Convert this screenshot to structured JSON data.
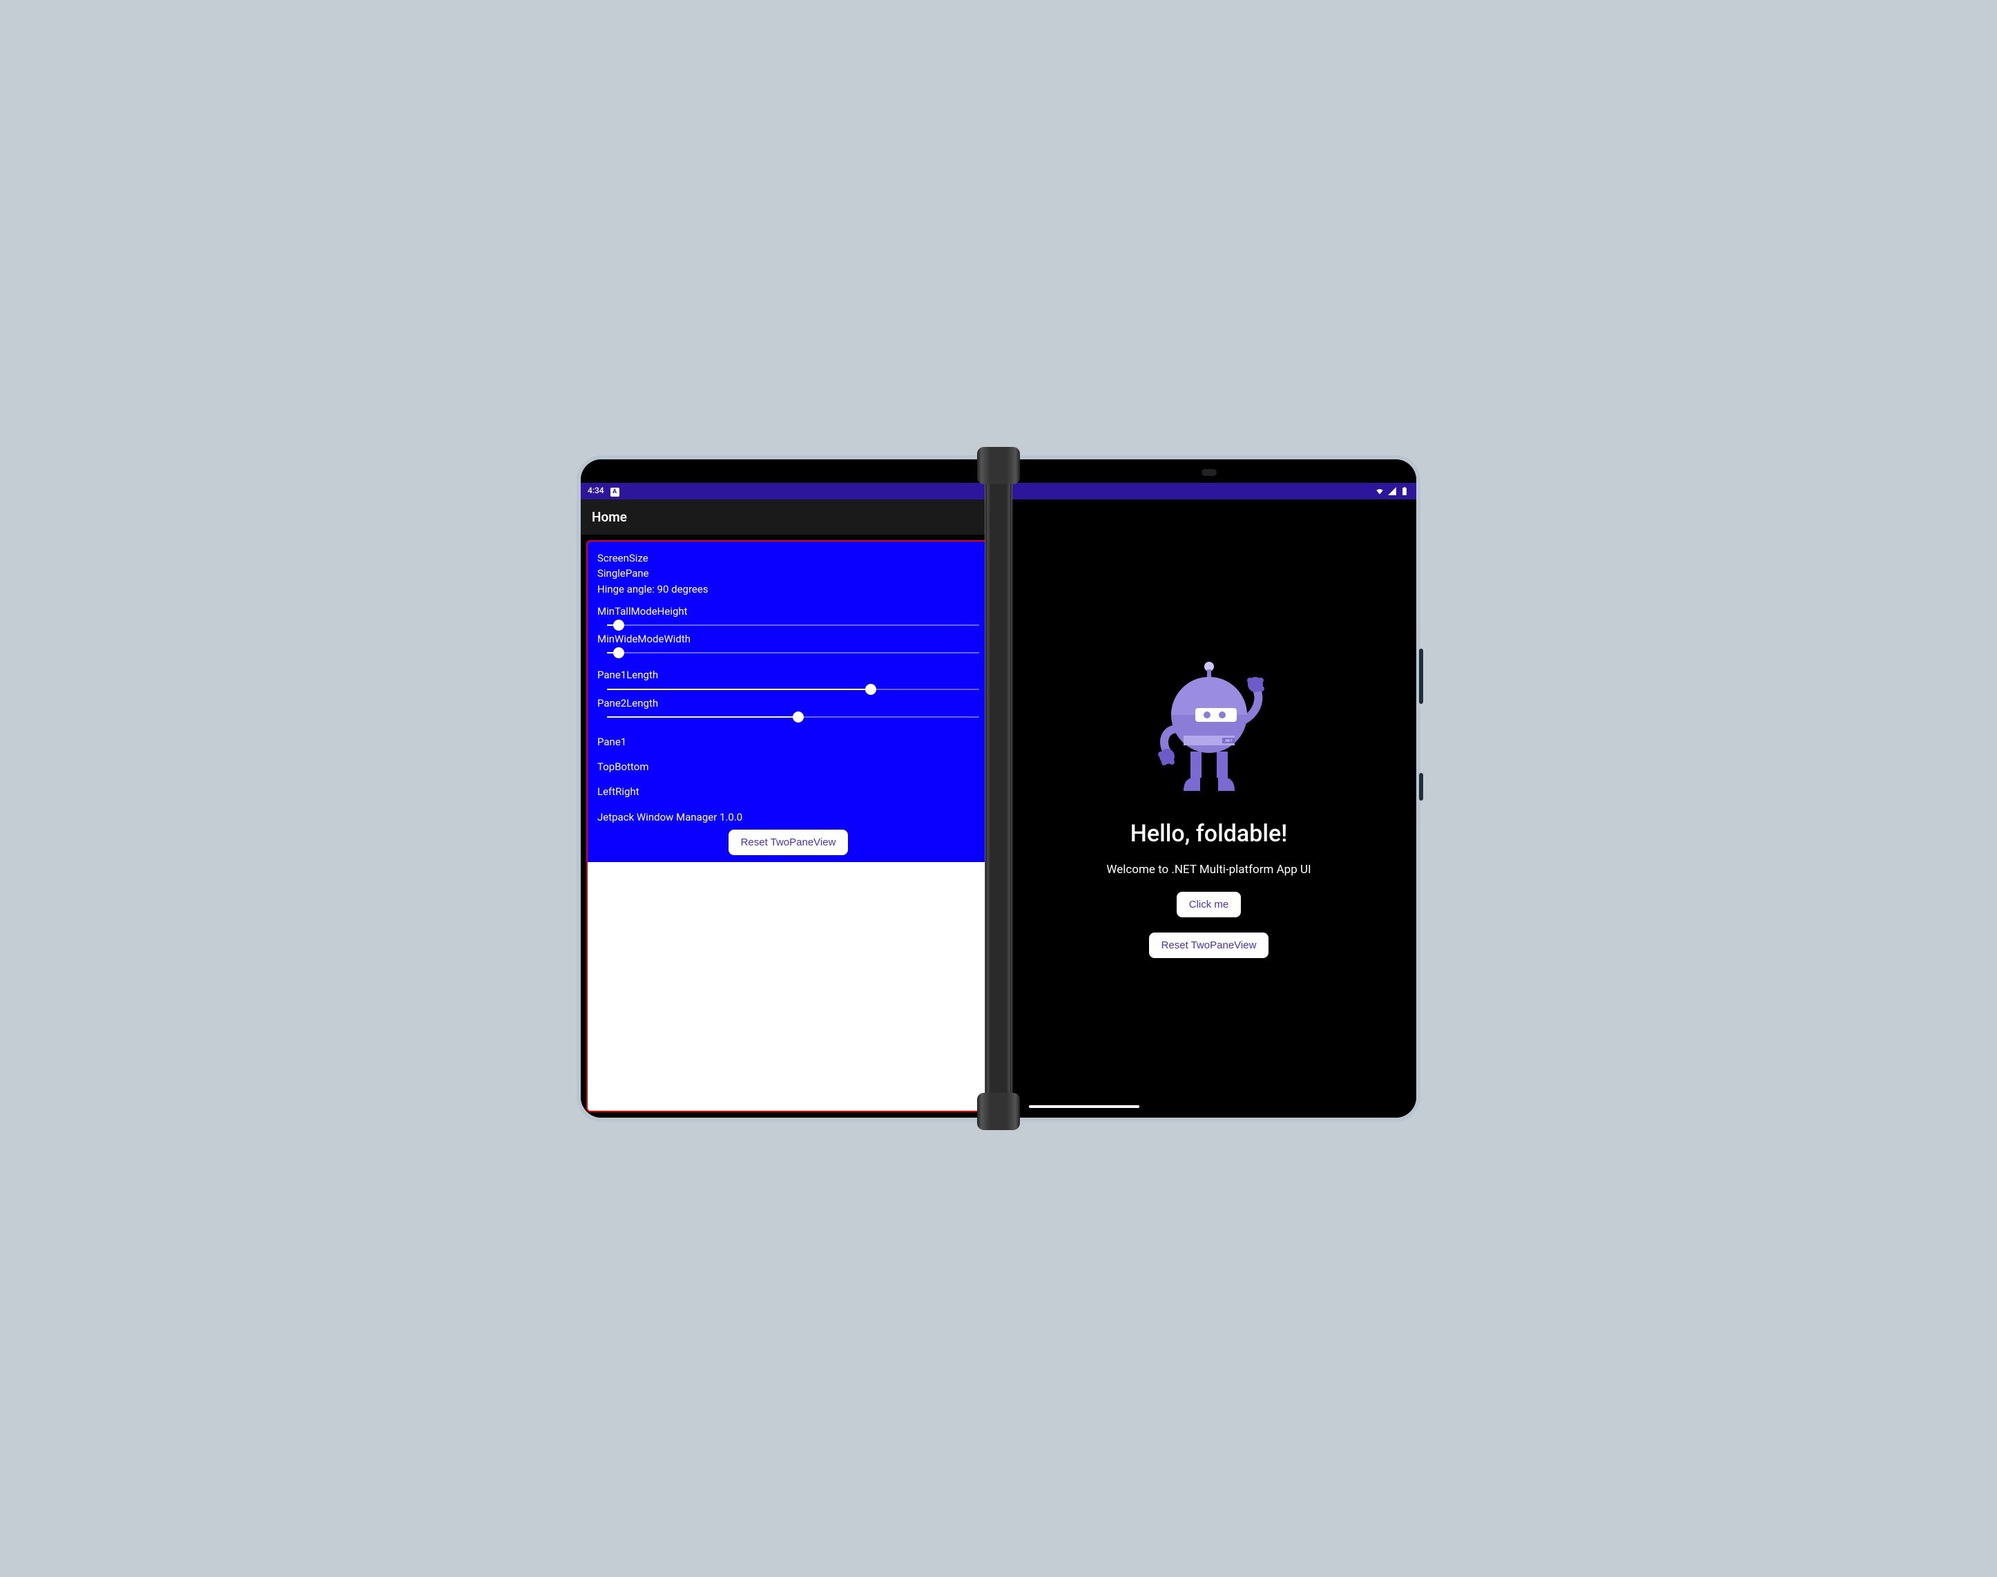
{
  "status": {
    "time": "4:34",
    "kbd": "A"
  },
  "appbar": {
    "title": "Home"
  },
  "pane1": {
    "screenSize": "ScreenSize",
    "paneMode": "SinglePane",
    "hingeAngle": "Hinge angle: 90 degrees",
    "minTallLabel": "MinTallModeHeight",
    "minWideLabel": "MinWideModeWidth",
    "pane1LengthLabel": "Pane1Length",
    "pane2LengthLabel": "Pane2Length",
    "paneLabel": "Pane1",
    "topBottomLabel": "TopBottom",
    "leftRightLabel": "LeftRight",
    "jetpackLabel": "Jetpack Window Manager 1.0.0",
    "resetLabel": "Reset TwoPaneView",
    "sliders": {
      "minTall": 0.03,
      "minWide": 0.03,
      "pane1Length": 0.69,
      "pane2Length": 0.5
    }
  },
  "pane2": {
    "title": "Hello, foldable!",
    "subtitle": "Welcome to .NET Multi-platform App UI",
    "clickMe": "Click me",
    "reset": "Reset TwoPaneView"
  },
  "colors": {
    "accent": "#4b2fc9",
    "bluePanel": "#0a00ff",
    "statusbar": "#2d169b",
    "redBorder": "#e60000"
  }
}
